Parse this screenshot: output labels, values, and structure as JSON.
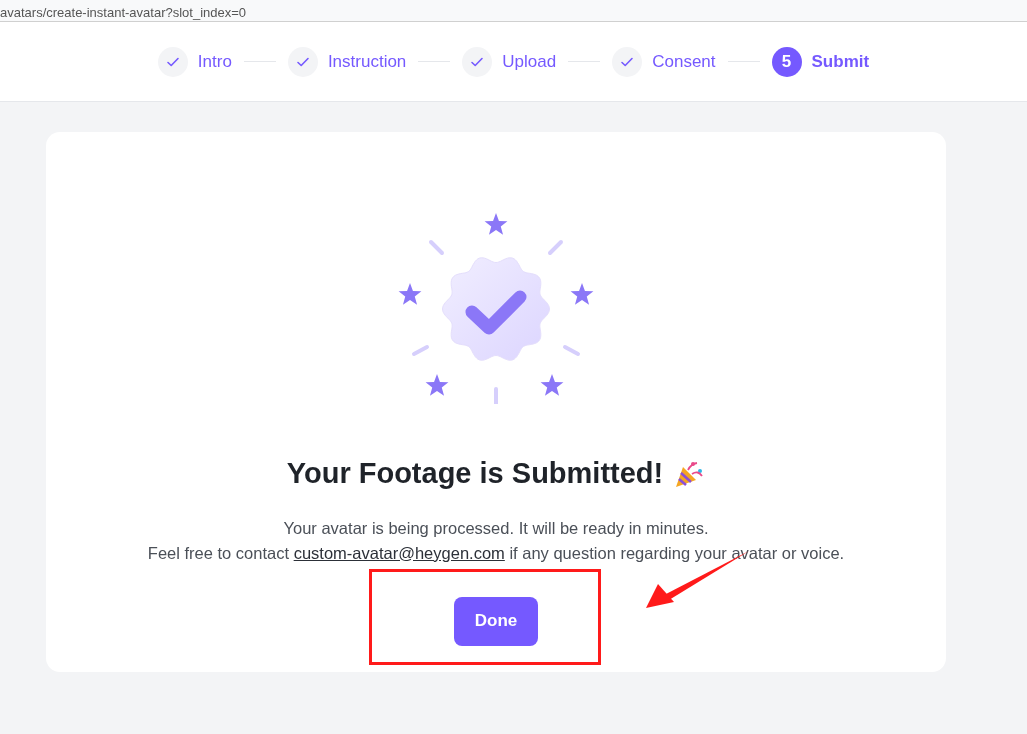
{
  "address_bar": {
    "url": "avatars/create-instant-avatar?slot_index=0"
  },
  "steps": [
    {
      "label": "Intro",
      "completed": true
    },
    {
      "label": "Instruction",
      "completed": true
    },
    {
      "label": "Upload",
      "completed": true
    },
    {
      "label": "Consent",
      "completed": true
    },
    {
      "label": "Submit",
      "completed": false,
      "number": "5"
    }
  ],
  "card": {
    "title": "Your Footage is Submitted!",
    "line_1": "Your avatar is being processed. It will be ready in minutes.",
    "line_2_before": "Feel free to contact",
    "email": "custom-avatar@heygen.com",
    "line_2_after": "if any question regarding your avatar or voice.",
    "button": "Done"
  }
}
